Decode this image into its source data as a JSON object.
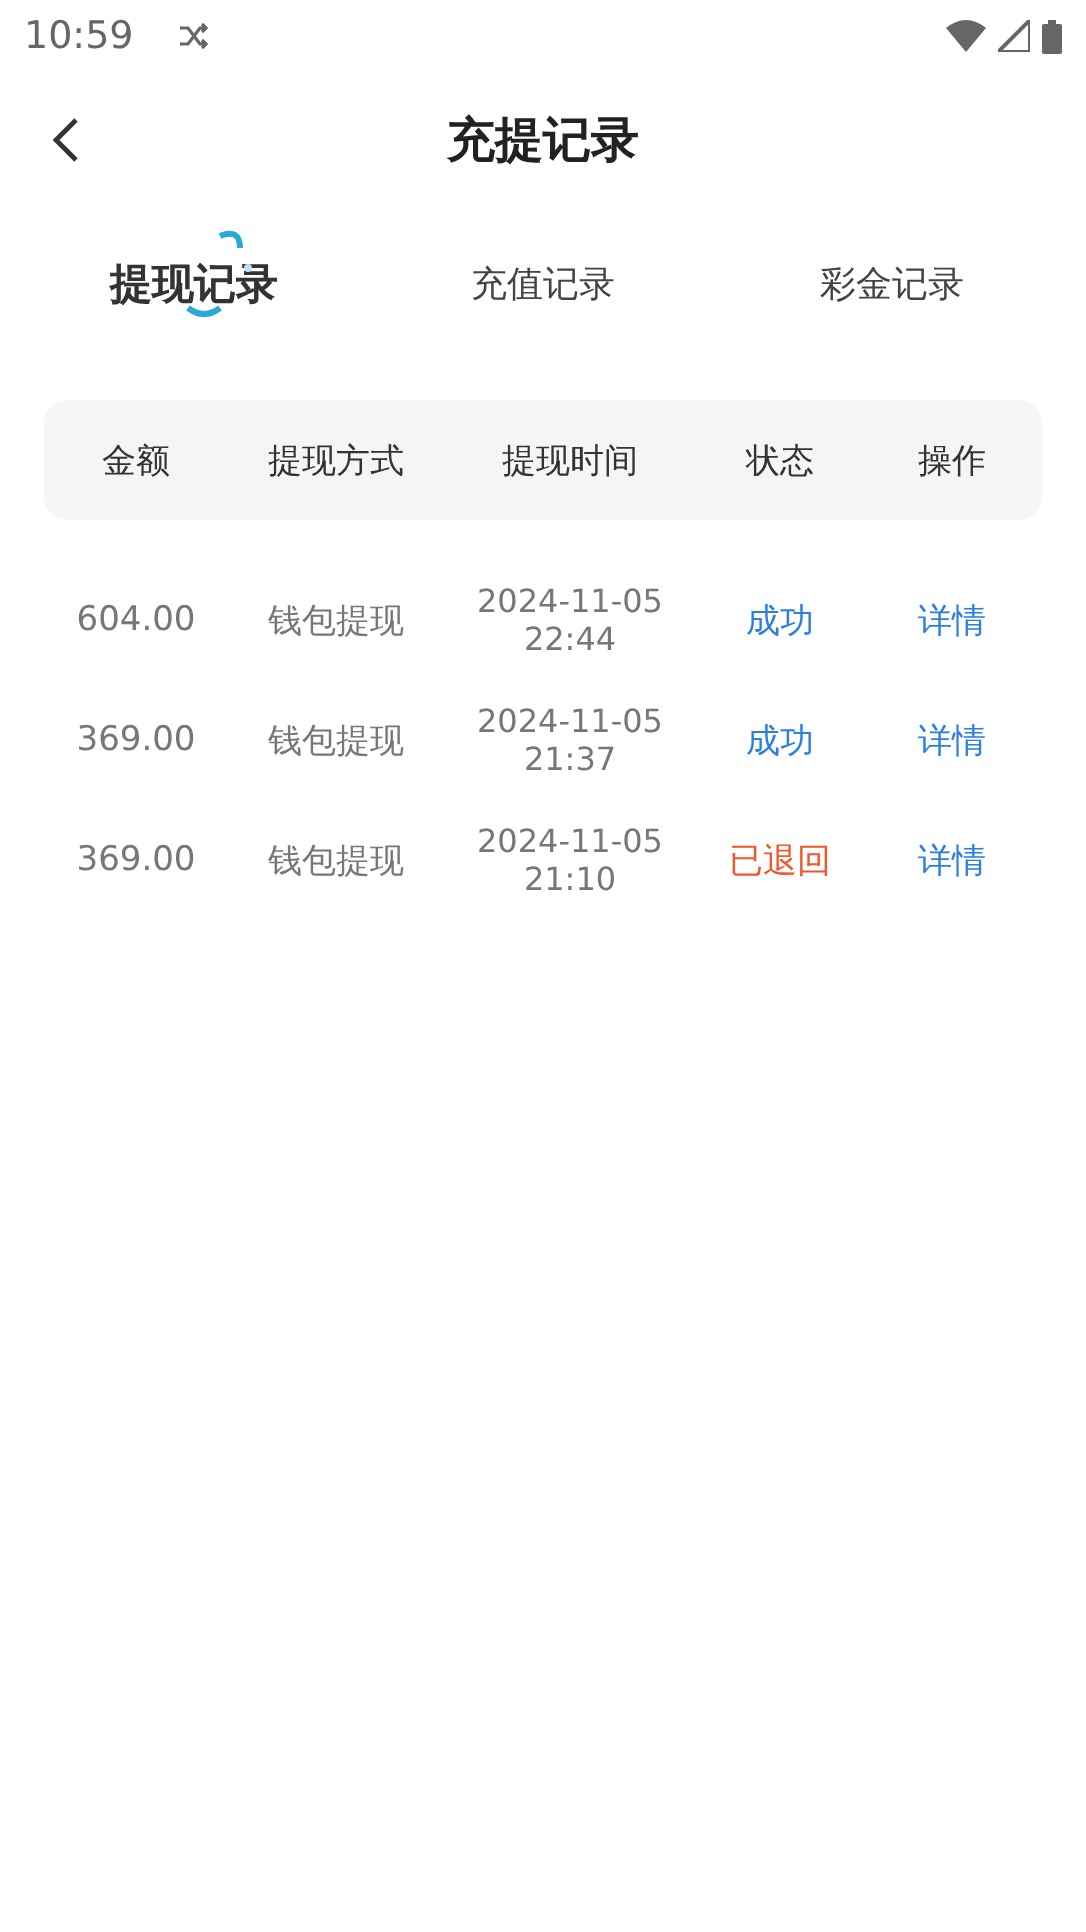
{
  "status_bar": {
    "time": "10:59"
  },
  "header": {
    "title": "充提记录"
  },
  "tabs": [
    {
      "label": "提现记录",
      "selected": true
    },
    {
      "label": "充值记录",
      "selected": false
    },
    {
      "label": "彩金记录",
      "selected": false
    }
  ],
  "table": {
    "columns": [
      "金额",
      "提现方式",
      "提现时间",
      "状态",
      "操作"
    ],
    "rows": [
      {
        "amount": "604.00",
        "method": "钱包提现",
        "time": "2024-11-05 22:44",
        "status": "成功",
        "color": "#2b7fe0",
        "action": "详情"
      },
      {
        "amount": "369.00",
        "method": "钱包提现",
        "time": "2024-11-05 21:37",
        "status": "成功",
        "color": "#2b7fe0",
        "action": "详情"
      },
      {
        "amount": "369.00",
        "method": "钱包提现",
        "time": "2024-11-05 21:10",
        "status": "已退回",
        "color": "#f0582c",
        "action": "详情"
      }
    ]
  }
}
